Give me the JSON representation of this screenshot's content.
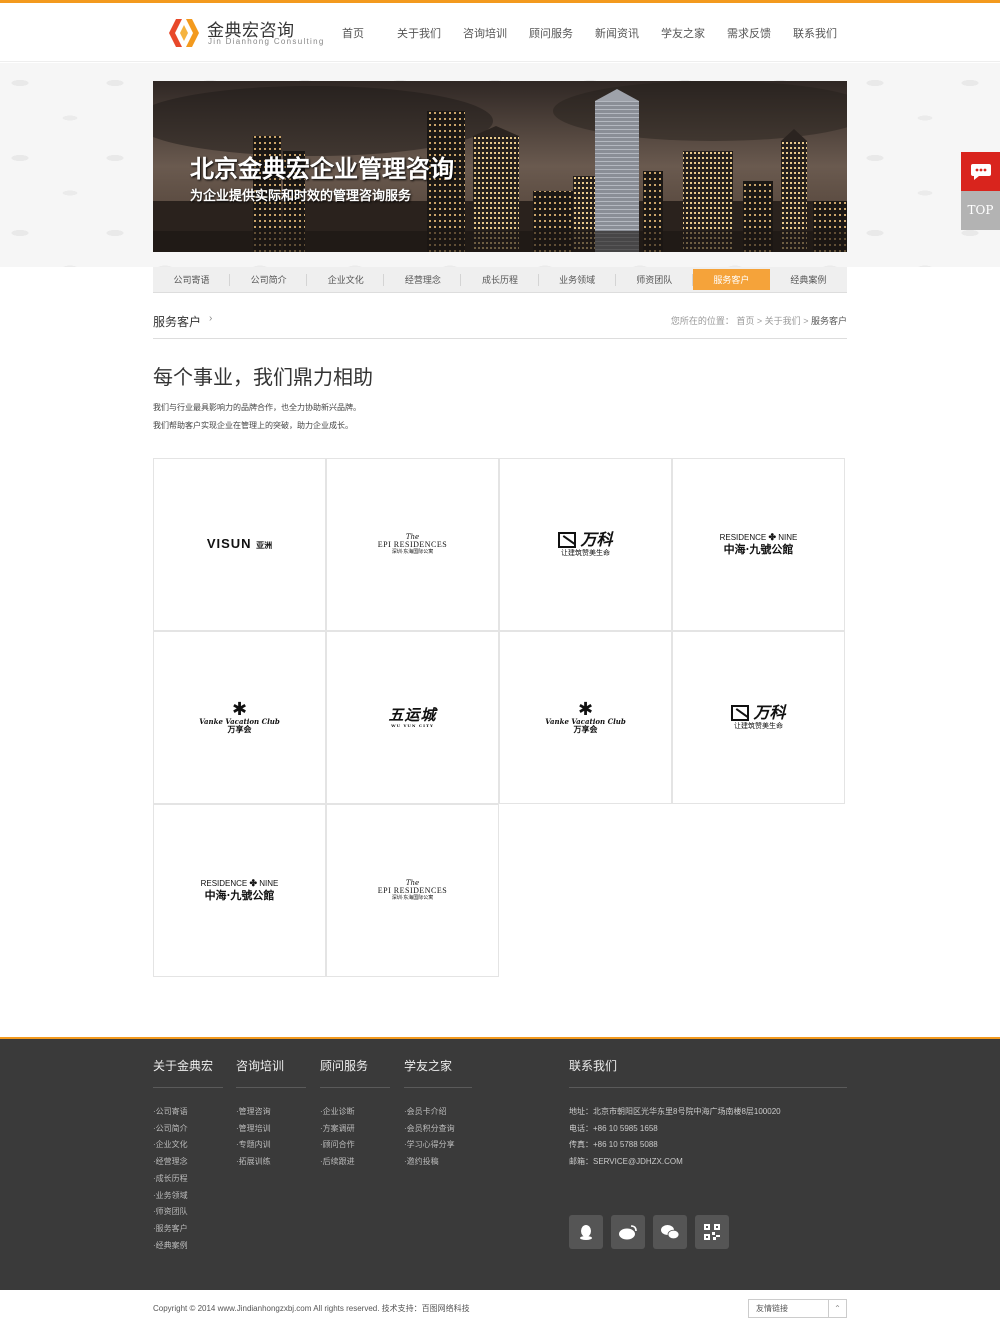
{
  "header": {
    "logo_cn": "金典宏咨询",
    "logo_en": "Jin Dianhong Consulting",
    "nav": [
      "首页",
      "关于我们",
      "咨询培训",
      "顾问服务",
      "新闻资讯",
      "学友之家",
      "需求反馈",
      "联系我们"
    ]
  },
  "banner": {
    "title": "北京金典宏企业管理咨询",
    "subtitle": "为企业提供实际和时效的管理咨询服务"
  },
  "subnav": {
    "items": [
      "公司寄语",
      "公司简介",
      "企业文化",
      "经营理念",
      "成长历程",
      "业务领域",
      "师资团队",
      "服务客户",
      "经典案例"
    ],
    "active": "服务客户"
  },
  "section": {
    "title": "服务客户",
    "arrow": "›",
    "crumb_prefix": "您所在的位置：",
    "crumb_home": "首页",
    "crumb_sep": ">",
    "crumb_parent": "关于我们",
    "crumb_current": "服务客户"
  },
  "content": {
    "headline": "每个事业，我们鼎力相助",
    "intro_line1": "我们与行业最具影响力的品牌合作，也全力协助新兴品牌。",
    "intro_line2": "我们帮助客户实现企业在管理上的突破，助力企业成长。"
  },
  "clients": {
    "visun": {
      "name": "VISUN",
      "cn": "亚洲"
    },
    "epi": {
      "top": "The",
      "main": "EPI RESIDENCES",
      "sub": "深圳·东海国际公寓"
    },
    "vanke": {
      "name": "万科",
      "sub": "让建筑赞美生命"
    },
    "residence": {
      "left": "RESIDENCE",
      "sep": "✤",
      "right": "NINE",
      "main": "中海·九號公館"
    },
    "club": {
      "mark": "✱",
      "en": "Vanke Vacation Club",
      "cn": "万享会"
    },
    "yun": {
      "name": "五运城",
      "sub": "WU YUN CITY"
    }
  },
  "footer": {
    "col1": {
      "title": "关于金典宏",
      "items": [
        "·公司寄语",
        "·公司简介",
        "·企业文化",
        "·经营理念",
        "·成长历程",
        "·业务领域",
        "·师资团队",
        "·服务客户",
        "·经典案例"
      ]
    },
    "col2": {
      "title": "咨询培训",
      "items": [
        "·管理咨询",
        "·管理培训",
        "·专题内训",
        "·拓展训练"
      ]
    },
    "col3": {
      "title": "顾问服务",
      "items": [
        "·企业诊断",
        "·方案调研",
        "·顾问合作",
        "·后续跟进"
      ]
    },
    "col4": {
      "title": "学友之家",
      "items": [
        "·会员卡介绍",
        "·会员积分查询",
        "·学习心得分享",
        "·邀约投稿"
      ]
    },
    "contact": {
      "title": "联系我们",
      "address": "地址：北京市朝阳区光华东里8号院中海广场南楼8层100020",
      "phone": "电话：+86 10 5985 1658",
      "fax": "传真：+86 10 5788 5088",
      "email": "邮箱：SERVICE@JDHZX.COM"
    },
    "social_icons": [
      "qq-icon",
      "weibo-icon",
      "wechat-icon",
      "qrcode-icon"
    ]
  },
  "bottom": {
    "copyright": "Copyright © 2014 www.Jindianhongzxbj.com All rights reserved.   技术支持：百图网络科技",
    "friend_links": "友情链接",
    "friend_arrow": "⌃"
  },
  "float": {
    "top_label": "TOP"
  },
  "colors": {
    "accent": "#f39a1e",
    "active_tab": "#f5a33a",
    "footer_bg": "#3a3a3a",
    "float_red": "#d9241d"
  }
}
